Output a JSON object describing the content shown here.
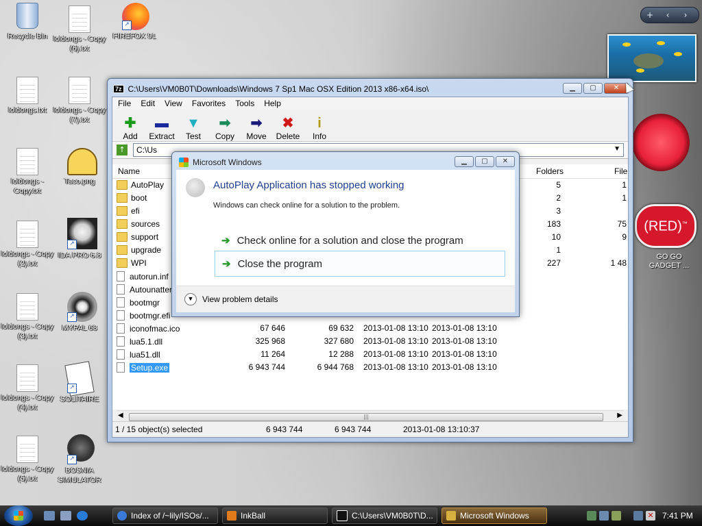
{
  "desktop": {
    "icons": [
      {
        "label": "Recycle Bin"
      },
      {
        "label": "loldongs - Copy (6).txt"
      },
      {
        "label": "FIREFOX 91"
      },
      {
        "label": "loldongs.txt"
      },
      {
        "label": "loldongs - Copy (7).txt"
      },
      {
        "label": "loldongs - Copy.txt"
      },
      {
        "label": "Taco.png"
      },
      {
        "label": "loldongs - Copy (2).txt"
      },
      {
        "label": "IDA PRO 6.8"
      },
      {
        "label": "loldongs - Copy (3).txt"
      },
      {
        "label": "MYPAL 68"
      },
      {
        "label": "loldongs - Copy (4).txt"
      },
      {
        "label": "SOLITAIRE"
      },
      {
        "label": "loldongs - Copy (5).txt"
      },
      {
        "label": "BOSNIA SIMULATOR"
      }
    ],
    "sidebar_controls": {
      "add": "+",
      "prev": "‹",
      "next": "›"
    },
    "red_gadget": {
      "text": "(RED)",
      "mark": "™",
      "label": "GO GO GADGET ..."
    }
  },
  "zip_window": {
    "title": "C:\\Users\\VM0B0T\\Downloads\\Windows 7 Sp1 Mac OSX Edition 2013 x86-x64.iso\\",
    "badge": "7z",
    "menu": [
      "File",
      "Edit",
      "View",
      "Favorites",
      "Tools",
      "Help"
    ],
    "toolbar": [
      {
        "label": "Add",
        "glyph": "✚",
        "color": "#1a9a1a"
      },
      {
        "label": "Extract",
        "glyph": "▬",
        "color": "#1a2a9a"
      },
      {
        "label": "Test",
        "glyph": "▼",
        "color": "#20b0c0"
      },
      {
        "label": "Copy",
        "glyph": "➡",
        "color": "#1a8a5a"
      },
      {
        "label": "Move",
        "glyph": "➡",
        "color": "#1a1a7a"
      },
      {
        "label": "Delete",
        "glyph": "✖",
        "color": "#d01a1a"
      },
      {
        "label": "Info",
        "glyph": "i",
        "color": "#b09a10"
      }
    ],
    "path": "C:\\Us",
    "columns": {
      "name": "Name",
      "folders": "Folders",
      "files": "File"
    },
    "rows": [
      {
        "name": "AutoPlay",
        "type": "folder",
        "folders": "5",
        "files": "1"
      },
      {
        "name": "boot",
        "type": "folder",
        "folders": "2",
        "files": "1"
      },
      {
        "name": "efi",
        "type": "folder",
        "folders": "3",
        "files": ""
      },
      {
        "name": "sources",
        "type": "folder",
        "folders": "183",
        "files": "75"
      },
      {
        "name": "support",
        "type": "folder",
        "folders": "10",
        "files": "9"
      },
      {
        "name": "upgrade",
        "type": "folder",
        "folders": "1",
        "files": ""
      },
      {
        "name": "WPI",
        "type": "folder",
        "folders": "227",
        "files": "1 48"
      },
      {
        "name": "autorun.inf",
        "type": "file"
      },
      {
        "name": "Autounatter",
        "type": "file"
      },
      {
        "name": "bootmgr",
        "type": "file"
      },
      {
        "name": "bootmgr.efi",
        "type": "file"
      },
      {
        "name": "iconofmac.ico",
        "type": "file",
        "size": "67 646",
        "packed": "69 632",
        "modified": "2013-01-08 13:10",
        "created": "2013-01-08 13:10"
      },
      {
        "name": "lua5.1.dll",
        "type": "file",
        "size": "325 968",
        "packed": "327 680",
        "modified": "2013-01-08 13:10",
        "created": "2013-01-08 13:10"
      },
      {
        "name": "lua51.dll",
        "type": "file",
        "size": "11 264",
        "packed": "12 288",
        "modified": "2013-01-08 13:10",
        "created": "2013-01-08 13:10"
      },
      {
        "name": "Setup.exe",
        "type": "file",
        "size": "6 943 744",
        "packed": "6 944 768",
        "modified": "2013-01-08 13:10",
        "created": "2013-01-08 13:10",
        "selected": true
      }
    ],
    "status": {
      "selection": "1 / 15 object(s) selected",
      "size": "6 943 744",
      "packed": "6 943 744",
      "date": "2013-01-08 13:10:37"
    }
  },
  "error_dialog": {
    "title": "Microsoft Windows",
    "heading": "AutoPlay Application has stopped working",
    "description": "Windows can check online for a solution to the problem.",
    "option1": "Check online for a solution and close the program",
    "option2": "Close the program",
    "details": "View problem details"
  },
  "taskbar": {
    "buttons": [
      {
        "label": "Index of /~lily/ISOs/...",
        "color": "#3a7ad8"
      },
      {
        "label": "InkBall",
        "color": "#e07a1a"
      },
      {
        "label": "C:\\Users\\VM0B0T\\D...",
        "color": "#111111"
      },
      {
        "label": "Microsoft Windows",
        "color": "#d8b040",
        "active": true
      }
    ],
    "time": "7:41 PM"
  }
}
